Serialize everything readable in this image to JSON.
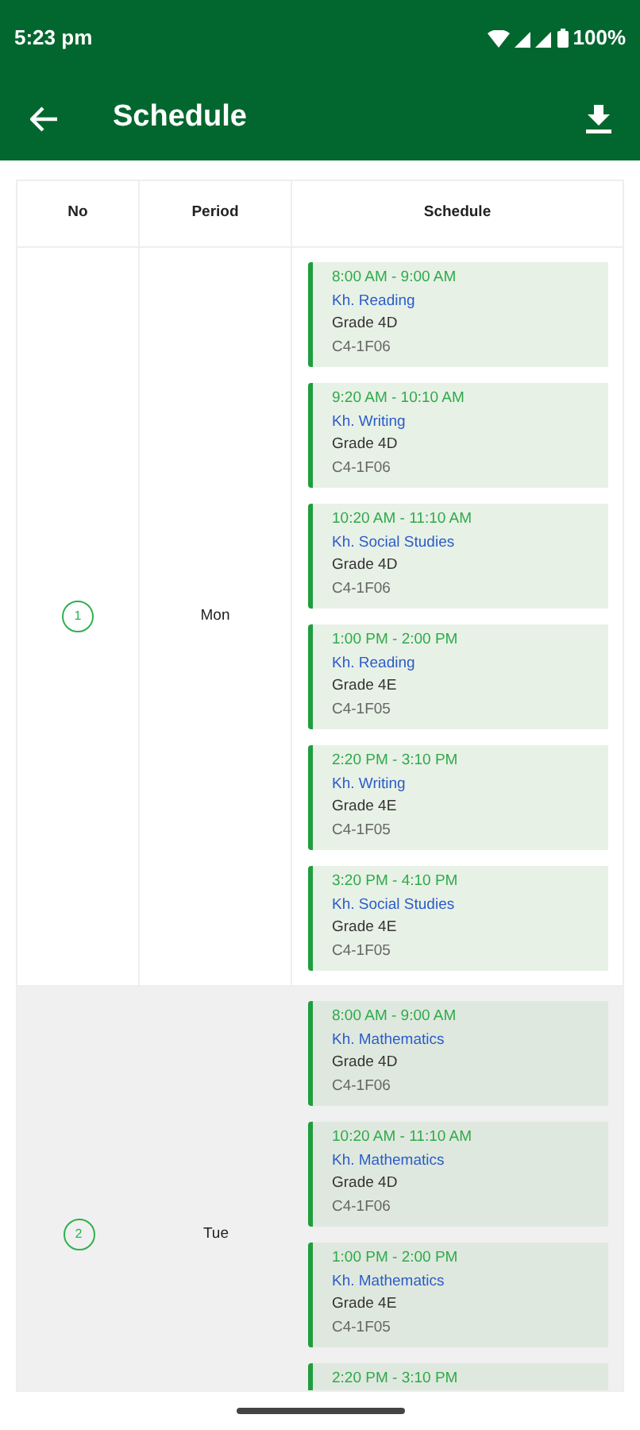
{
  "status_bar": {
    "time": "5:23 pm",
    "battery": "100%"
  },
  "app_bar": {
    "title": "Schedule"
  },
  "table": {
    "columns": [
      "No",
      "Period",
      "Schedule"
    ],
    "rows": [
      {
        "no": "1",
        "period": "Mon",
        "selected": false,
        "sessions": [
          {
            "time": "8:00 AM - 9:00 AM",
            "subject": "Kh. Reading",
            "grade": "Grade 4D",
            "room": "C4-1F06"
          },
          {
            "time": "9:20 AM - 10:10 AM",
            "subject": "Kh. Writing",
            "grade": "Grade 4D",
            "room": "C4-1F06"
          },
          {
            "time": "10:20 AM - 11:10 AM",
            "subject": "Kh. Social Studies",
            "grade": "Grade 4D",
            "room": "C4-1F06"
          },
          {
            "time": "1:00 PM - 2:00 PM",
            "subject": "Kh. Reading",
            "grade": "Grade 4E",
            "room": "C4-1F05"
          },
          {
            "time": "2:20 PM - 3:10 PM",
            "subject": "Kh. Writing",
            "grade": "Grade 4E",
            "room": "C4-1F05"
          },
          {
            "time": "3:20 PM - 4:10 PM",
            "subject": "Kh. Social Studies",
            "grade": "Grade 4E",
            "room": "C4-1F05"
          }
        ]
      },
      {
        "no": "2",
        "period": "Tue",
        "selected": true,
        "sessions": [
          {
            "time": "8:00 AM - 9:00 AM",
            "subject": "Kh. Mathematics",
            "grade": "Grade 4D",
            "room": "C4-1F06"
          },
          {
            "time": "10:20 AM - 11:10 AM",
            "subject": "Kh. Mathematics",
            "grade": "Grade 4D",
            "room": "C4-1F06"
          },
          {
            "time": "1:00 PM - 2:00 PM",
            "subject": "Kh. Mathematics",
            "grade": "Grade 4E",
            "room": "C4-1F05"
          },
          {
            "time": "2:20 PM - 3:10 PM"
          }
        ]
      }
    ]
  }
}
